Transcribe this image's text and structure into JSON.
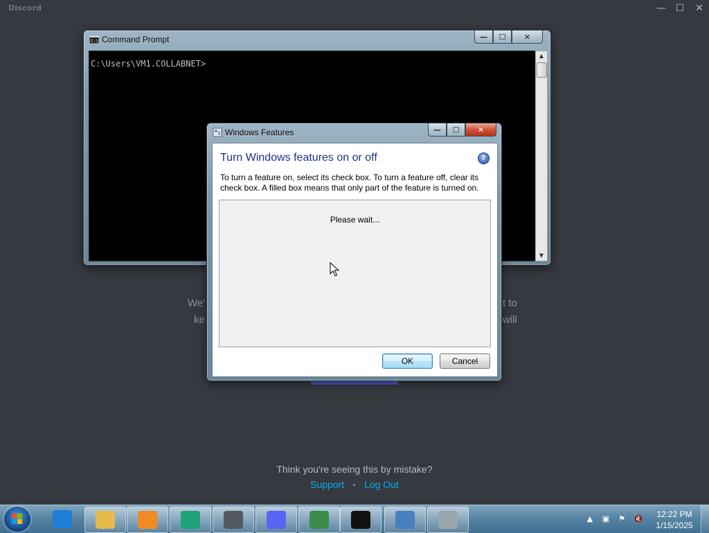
{
  "discord": {
    "brand": "Discord",
    "bg_left_1": "We'",
    "bg_left_2": "ke",
    "bg_right_1": "t to",
    "bg_right_2": "will",
    "mistake_text": "Think you're seeing this by mistake?",
    "support_link": "Support",
    "separator": "•",
    "logout_link": "Log Out",
    "controls": [
      "—",
      "☐",
      "✕"
    ]
  },
  "cmd": {
    "title": "Command Prompt",
    "prompt_line": "C:\\Users\\VM1.COLLABNET>",
    "buttons": [
      "—",
      "☐",
      "✕"
    ]
  },
  "windows_features": {
    "title": "Windows Features",
    "heading": "Turn Windows features on or off",
    "help": "?",
    "description": "To turn a feature on, select its check box. To turn a feature off, clear its check box. A filled box means that only part of the feature is turned on.",
    "status": "Please wait...",
    "ok_label": "OK",
    "cancel_label": "Cancel",
    "buttons": [
      "—",
      "☐",
      "✕"
    ]
  },
  "taskbar": {
    "time": "12:22 PM",
    "date": "1/15/2025",
    "apps": [
      {
        "name": "internet-explorer-icon",
        "color": "#1d7fd6"
      },
      {
        "name": "file-explorer-icon",
        "color": "#e7b94b"
      },
      {
        "name": "media-player-icon",
        "color": "#f08a24"
      },
      {
        "name": "green-app-icon",
        "color": "#1fa37a"
      },
      {
        "name": "winsd-app-icon",
        "color": "#555a61"
      },
      {
        "name": "discord-icon",
        "color": "#5865f2"
      },
      {
        "name": "remote-desktop-icon",
        "color": "#3c8c4a"
      },
      {
        "name": "cmd-icon",
        "color": "#111111"
      },
      {
        "name": "network-search-icon",
        "color": "#4a7fc0"
      },
      {
        "name": "windows-features-icon",
        "color": "#9aa6ad"
      }
    ]
  }
}
